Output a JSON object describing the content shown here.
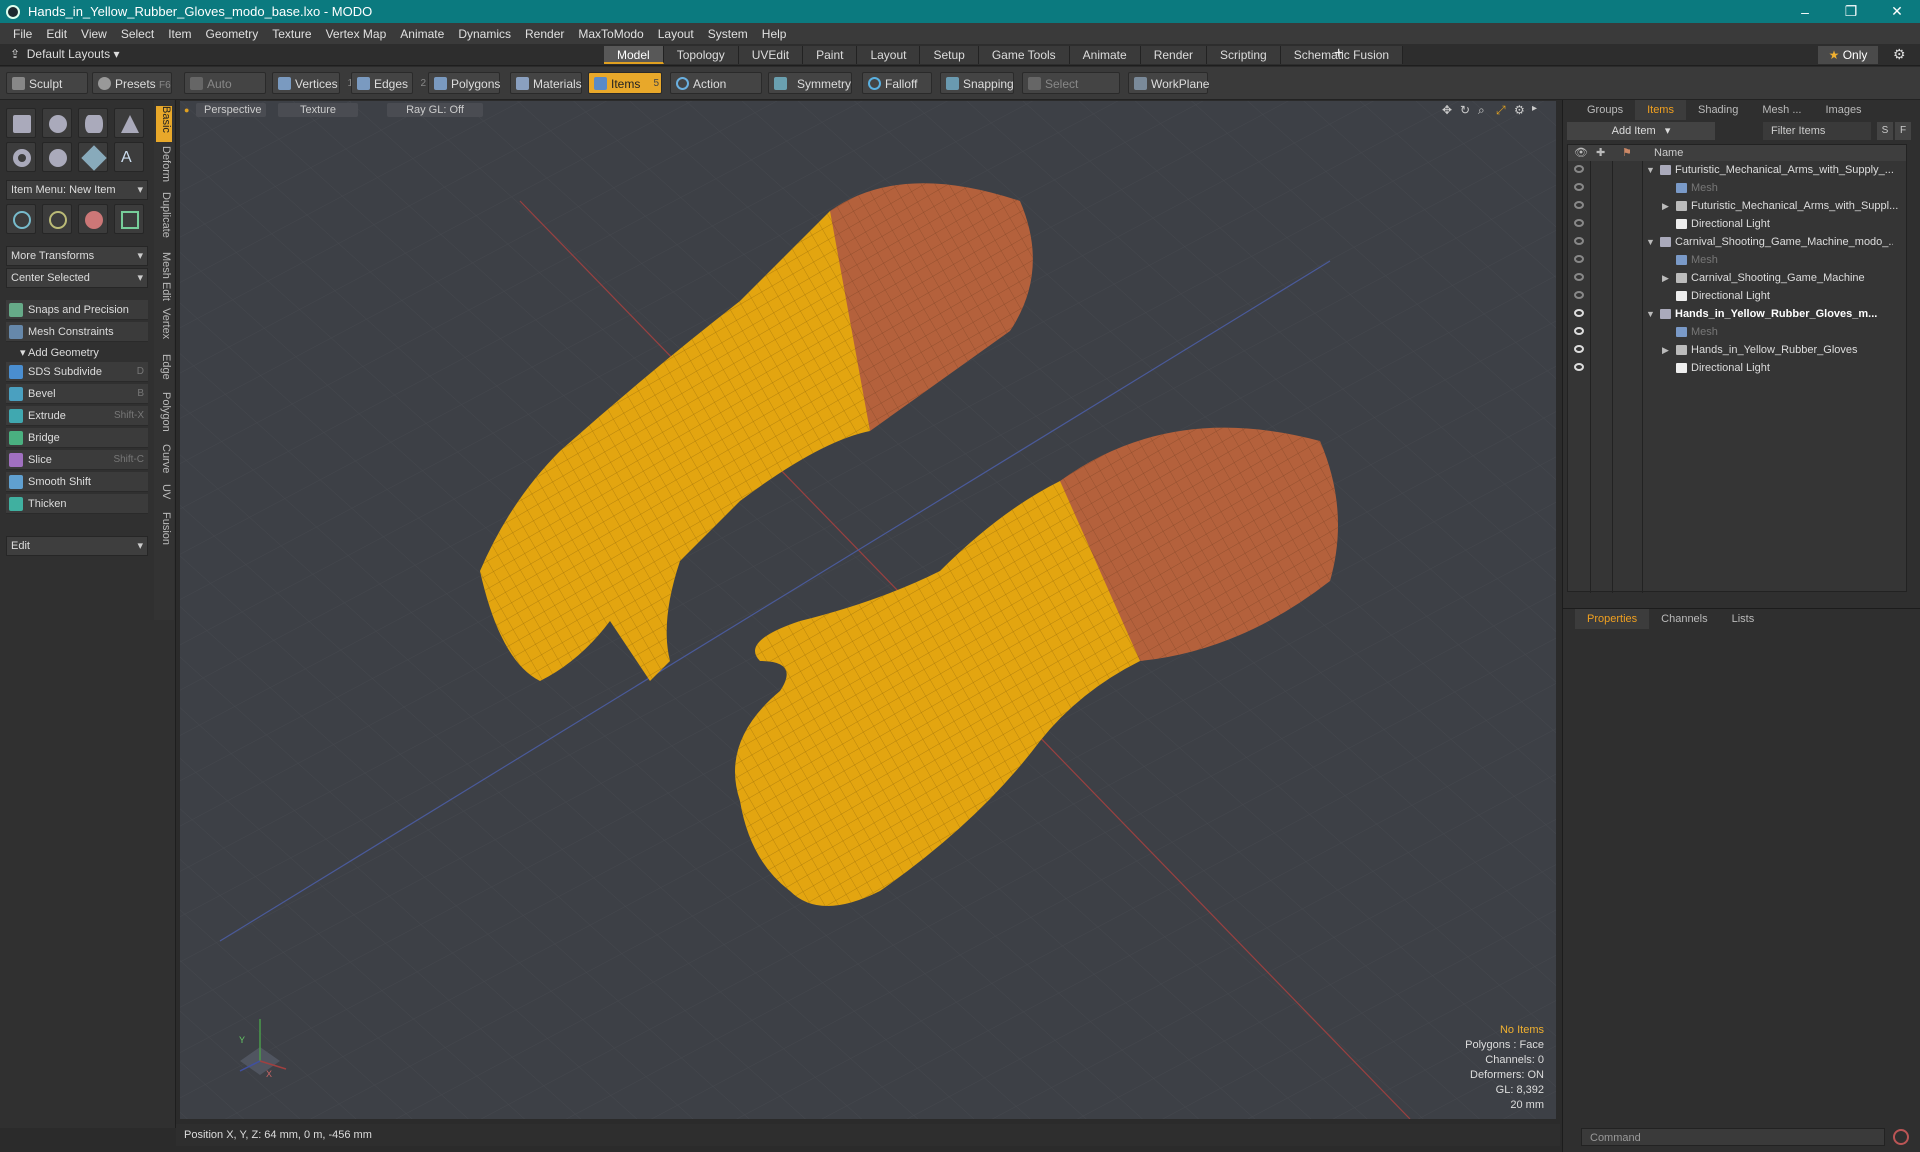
{
  "window": {
    "title": "Hands_in_Yellow_Rubber_Gloves_modo_base.lxo - MODO",
    "controls": [
      "–",
      "❐",
      "✕"
    ]
  },
  "menu": [
    "File",
    "Edit",
    "View",
    "Select",
    "Item",
    "Geometry",
    "Texture",
    "Vertex Map",
    "Animate",
    "Dynamics",
    "Render",
    "MaxToModo",
    "Layout",
    "System",
    "Help"
  ],
  "layout": {
    "default_layouts": "Default Layouts",
    "tabs": [
      "Model",
      "Topology",
      "UVEdit",
      "Paint",
      "Layout",
      "Setup",
      "Game Tools",
      "Animate",
      "Render",
      "Scripting",
      "Schematic Fusion"
    ],
    "active_tab": "Model",
    "only_label": "Only"
  },
  "toolbar": {
    "sculpt": "Sculpt",
    "presets": "Presets",
    "presets_key": "F6",
    "auto_select": "Auto Select",
    "vertices": "Vertices",
    "vertices_key": "1",
    "edges": "Edges",
    "edges_key": "2",
    "polygons": "Polygons",
    "materials": "Materials",
    "items": "Items",
    "items_key": "5",
    "action_center": "Action Center",
    "symmetry": "Symmetry",
    "falloff": "Falloff",
    "snapping": "Snapping",
    "select_through": "Select Through",
    "workplane": "WorkPlane"
  },
  "left": {
    "vtabs": [
      "Basic",
      "Deform",
      "Duplicate",
      "Mesh Edit",
      "Vertex",
      "Edge",
      "Polygon",
      "Curve",
      "UV",
      "Fusion"
    ],
    "item_menu": "Item Menu: New Item",
    "more_transforms": "More Transforms",
    "center_selected": "Center Selected",
    "snaps": "Snaps and Precision",
    "mesh_constraints": "Mesh Constraints",
    "add_geometry": "Add Geometry",
    "tools": [
      {
        "label": "SDS Subdivide",
        "key": "D",
        "color": "#4a8ed0"
      },
      {
        "label": "Bevel",
        "key": "B",
        "color": "#4aa0c0"
      },
      {
        "label": "Extrude",
        "key": "Shift-X",
        "color": "#40a8b0"
      },
      {
        "label": "Bridge",
        "key": "",
        "color": "#4ab080"
      },
      {
        "label": "Slice",
        "key": "Shift-C",
        "color": "#a070c0"
      },
      {
        "label": "Smooth Shift",
        "key": "",
        "color": "#60a0d0"
      },
      {
        "label": "Thicken",
        "key": "",
        "color": "#40b0a0"
      }
    ],
    "edit": "Edit"
  },
  "viewport": {
    "perspective": "Perspective",
    "texture": "Texture",
    "raygl": "Ray GL: Off",
    "stats": {
      "no_items": "No Items",
      "polygons": "Polygons : Face",
      "channels": "Channels: 0",
      "deformers": "Deformers: ON",
      "gl": "GL: 8,392",
      "scale": "20 mm"
    },
    "axis": {
      "y": "Y",
      "x": "X"
    }
  },
  "status": {
    "position": "Position X, Y, Z:  64 mm, 0 m, -456 mm"
  },
  "right": {
    "tabs": [
      "Groups",
      "Items",
      "Shading",
      "Mesh ...",
      "Images"
    ],
    "active_tab": "Items",
    "add_item": "Add Item",
    "filter": "Filter Items",
    "btn_s": "S",
    "btn_f": "F",
    "name_header": "Name",
    "rows": [
      {
        "label": "Futuristic_Mechanical_Arms_with_Supply_...",
        "indent": 0,
        "type": "scene",
        "arrow": "▼",
        "eye": false,
        "style": ""
      },
      {
        "label": "Mesh",
        "indent": 2,
        "type": "mesh",
        "arrow": "",
        "eye": false,
        "style": "dim"
      },
      {
        "label": "Futuristic_Mechanical_Arms_with_Suppl...",
        "indent": 2,
        "type": "group",
        "arrow": "▶",
        "eye": false,
        "style": ""
      },
      {
        "label": "Directional Light",
        "indent": 2,
        "type": "light",
        "arrow": "",
        "eye": false,
        "style": ""
      },
      {
        "label": "Carnival_Shooting_Game_Machine_modo_...",
        "indent": 0,
        "type": "scene",
        "arrow": "▼",
        "eye": false,
        "style": ""
      },
      {
        "label": "Mesh",
        "indent": 2,
        "type": "mesh",
        "arrow": "",
        "eye": false,
        "style": "dim"
      },
      {
        "label": "Carnival_Shooting_Game_Machine",
        "indent": 2,
        "type": "group",
        "arrow": "▶",
        "eye": false,
        "style": ""
      },
      {
        "label": "Directional Light",
        "indent": 2,
        "type": "light",
        "arrow": "",
        "eye": false,
        "style": ""
      },
      {
        "label": "Hands_in_Yellow_Rubber_Gloves_m...",
        "indent": 0,
        "type": "scene",
        "arrow": "▼",
        "eye": true,
        "style": "bold"
      },
      {
        "label": "Mesh",
        "indent": 2,
        "type": "mesh",
        "arrow": "",
        "eye": true,
        "style": "dim"
      },
      {
        "label": "Hands_in_Yellow_Rubber_Gloves",
        "indent": 2,
        "type": "group",
        "arrow": "▶",
        "eye": true,
        "style": ""
      },
      {
        "label": "Directional Light",
        "indent": 2,
        "type": "light",
        "arrow": "",
        "eye": true,
        "style": ""
      }
    ],
    "prop_tabs": [
      "Properties",
      "Channels",
      "Lists"
    ],
    "prop_active": "Properties",
    "command": "Command"
  },
  "colors": {
    "accent": "#e8a82a",
    "title_bar": "#0b7a7f",
    "glove": "#e3a510",
    "skin": "#b8603a"
  }
}
